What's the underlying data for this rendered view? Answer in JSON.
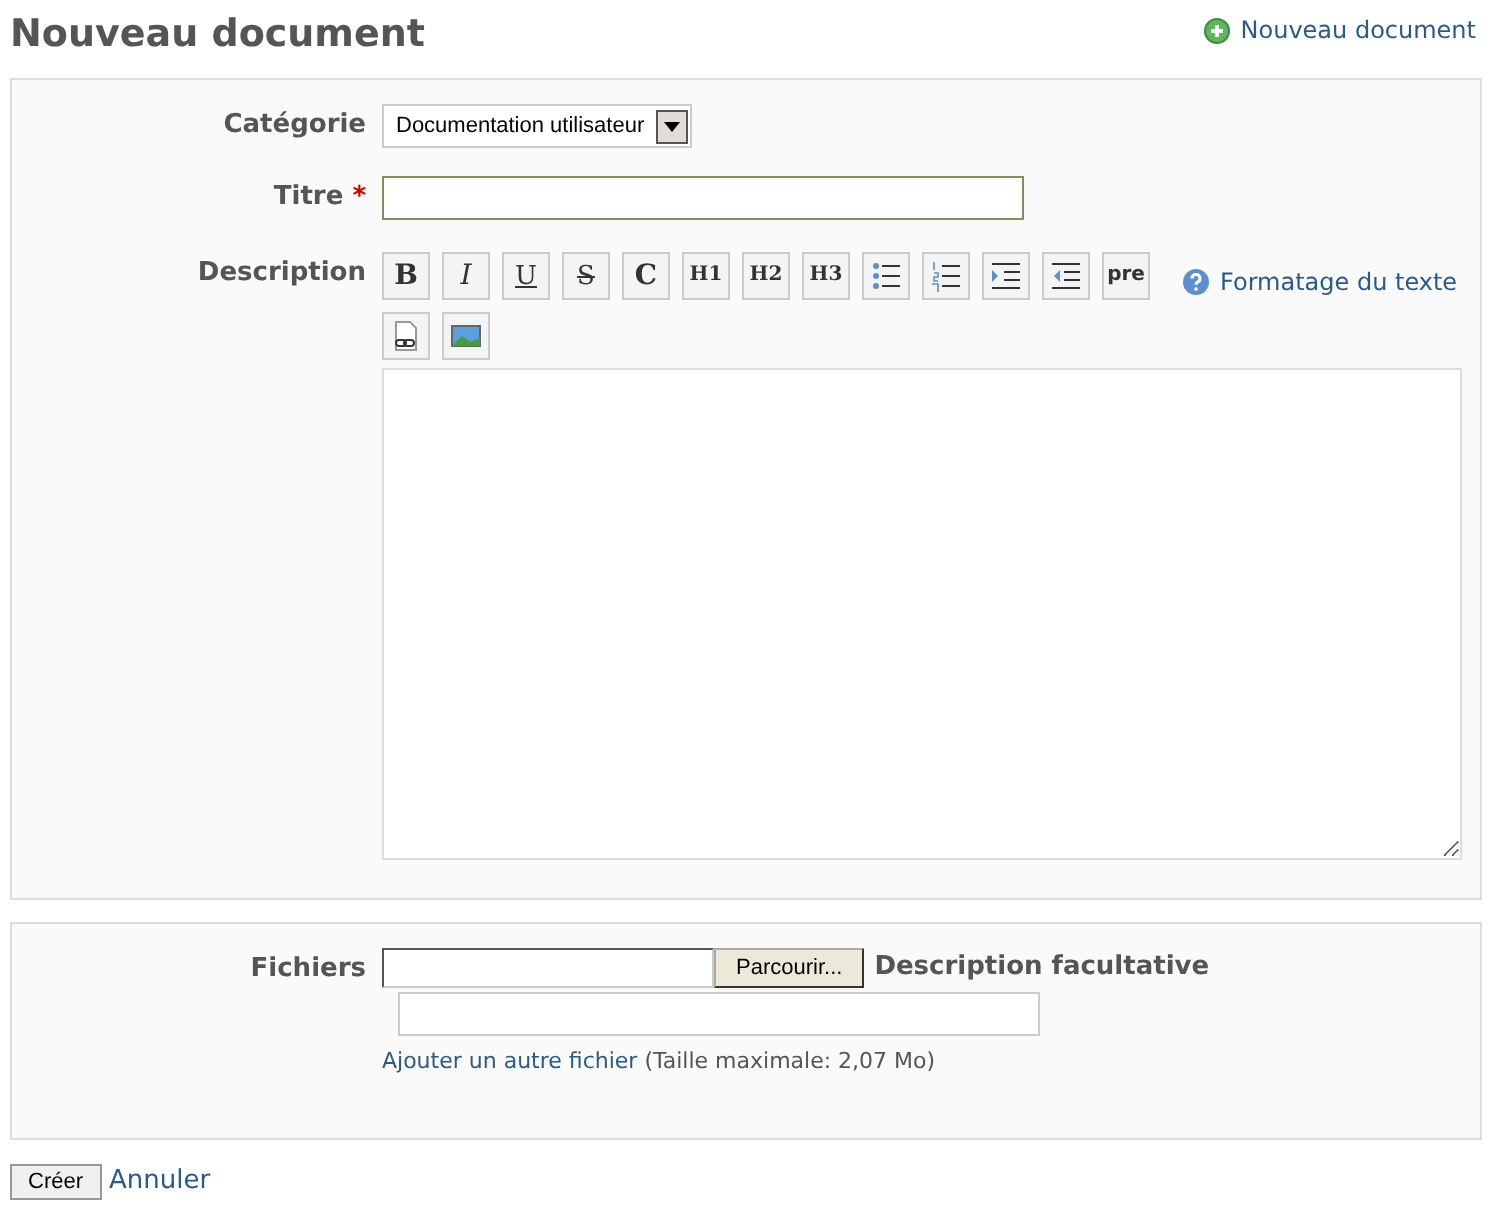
{
  "page_title": "Nouveau document",
  "header_link": "Nouveau document",
  "category": {
    "label": "Catégorie",
    "value": "Documentation utilisateur"
  },
  "title_field": {
    "label": "Titre",
    "required_mark": "*"
  },
  "description": {
    "label": "Description",
    "help_link": "Formatage du texte",
    "toolbar": [
      {
        "kind": "bold",
        "label": "B"
      },
      {
        "kind": "italic",
        "label": "I"
      },
      {
        "kind": "underline",
        "label": "U"
      },
      {
        "kind": "strike",
        "label": "S"
      },
      {
        "kind": "code",
        "label": "C"
      },
      {
        "kind": "heading",
        "label": "H1"
      },
      {
        "kind": "heading",
        "label": "H2"
      },
      {
        "kind": "heading",
        "label": "H3"
      },
      {
        "kind": "ul"
      },
      {
        "kind": "ol"
      },
      {
        "kind": "indent"
      },
      {
        "kind": "outdent"
      },
      {
        "kind": "pre",
        "label": "pre"
      },
      {
        "kind": "link"
      },
      {
        "kind": "image"
      }
    ]
  },
  "files": {
    "label": "Fichiers",
    "browse_button": "Parcourir...",
    "description_label": "Description facultative",
    "add_link": "Ajouter un autre fichier",
    "max_size": "(Taille maximale: 2,07 Mo)"
  },
  "buttons": {
    "submit": "Créer",
    "cancel": "Annuler"
  }
}
